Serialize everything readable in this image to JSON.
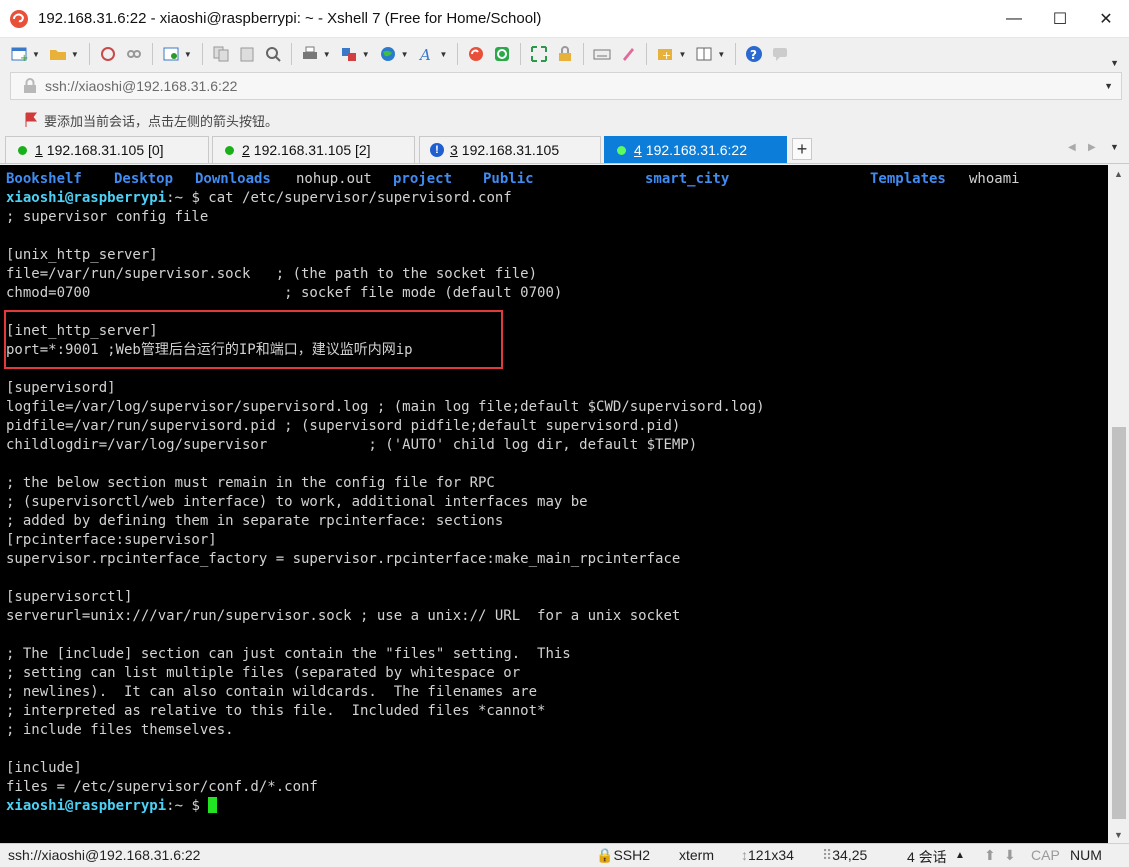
{
  "window": {
    "title": "192.168.31.6:22 - xiaoshi@raspberrypi: ~ - Xshell 7 (Free for Home/School)",
    "minimize": "—",
    "maximize": "☐",
    "close": "✕"
  },
  "toolbar": {
    "icons": [
      "new-session-icon",
      "open-folder-icon",
      "reconnect-icon",
      "disconnect-icon",
      "properties-icon",
      "copy-icon",
      "paste-icon",
      "find-icon",
      "print-icon",
      "transfer-icon",
      "globe-icon",
      "font-icon",
      "xshell-icon",
      "xftp-icon",
      "fullscreen-icon",
      "lock-icon",
      "keyboard-icon",
      "highlighter-icon",
      "add-pane-icon",
      "layout-icon",
      "help-icon",
      "chat-icon"
    ]
  },
  "address_bar": {
    "value": "ssh://xiaoshi@192.168.31.6:22"
  },
  "hint_bar": {
    "text": "要添加当前会话，点击左侧的箭头按钮。"
  },
  "tabs": [
    {
      "num": "1",
      "label": "192.168.31.105 [0]",
      "status": "connected",
      "active": false
    },
    {
      "num": "2",
      "label": "192.168.31.105 [2]",
      "status": "connected",
      "active": false
    },
    {
      "num": "3",
      "label": "192.168.31.105",
      "status": "warning",
      "active": false
    },
    {
      "num": "4",
      "label": "192.168.31.6:22",
      "status": "connected",
      "active": true
    }
  ],
  "terminal": {
    "ls_items": [
      {
        "text": "Bookshelf",
        "kind": "dir"
      },
      {
        "text": "Desktop",
        "kind": "dir"
      },
      {
        "text": "Downloads",
        "kind": "dir"
      },
      {
        "text": "nohup.out",
        "kind": "file"
      },
      {
        "text": "project",
        "kind": "dir"
      },
      {
        "text": "Public",
        "kind": "dir"
      },
      {
        "text": "smart_city",
        "kind": "dir"
      },
      {
        "text": "Templates",
        "kind": "dir"
      },
      {
        "text": "whoami",
        "kind": "file"
      }
    ],
    "prompt_user": "xiaoshi@raspberrypi",
    "prompt_path": ":~ $",
    "command": " cat /etc/supervisor/supervisord.conf",
    "lines": [
      "; supervisor config file",
      "",
      "[unix_http_server]",
      "file=/var/run/supervisor.sock   ; (the path to the socket file)",
      "chmod=0700                       ; sockef file mode (default 0700)",
      "",
      "[inet_http_server]",
      "port=*:9001 ;Web管理后台运行的IP和端口，建议监听内网ip",
      "",
      "[supervisord]",
      "logfile=/var/log/supervisor/supervisord.log ; (main log file;default $CWD/supervisord.log)",
      "pidfile=/var/run/supervisord.pid ; (supervisord pidfile;default supervisord.pid)",
      "childlogdir=/var/log/supervisor            ; ('AUTO' child log dir, default $TEMP)",
      "",
      "; the below section must remain in the config file for RPC",
      "; (supervisorctl/web interface) to work, additional interfaces may be",
      "; added by defining them in separate rpcinterface: sections",
      "[rpcinterface:supervisor]",
      "supervisor.rpcinterface_factory = supervisor.rpcinterface:make_main_rpcinterface",
      "",
      "[supervisorctl]",
      "serverurl=unix:///var/run/supervisor.sock ; use a unix:// URL  for a unix socket",
      "",
      "; The [include] section can just contain the \"files\" setting.  This",
      "; setting can list multiple files (separated by whitespace or",
      "; newlines).  It can also contain wildcards.  The filenames are",
      "; interpreted as relative to this file.  Included files *cannot*",
      "; include files themselves.",
      "",
      "[include]",
      "files = /etc/supervisor/conf.d/*.conf"
    ]
  },
  "status_bar": {
    "connection": "ssh://xiaoshi@192.168.31.6:22",
    "protocol": "SSH2",
    "term": "xterm",
    "size": "121x34",
    "position": "34,25",
    "sessions": "4 会话",
    "caps": "CAP",
    "num": "NUM"
  },
  "colors": {
    "accent": "#0c7dd8",
    "terminal_bg": "#000000",
    "terminal_fg": "#d2d2d2",
    "dir": "#3f8cf2",
    "prompt": "#4cd2f7",
    "cursor": "#21e321",
    "highlight_box": "#e23a3a"
  }
}
